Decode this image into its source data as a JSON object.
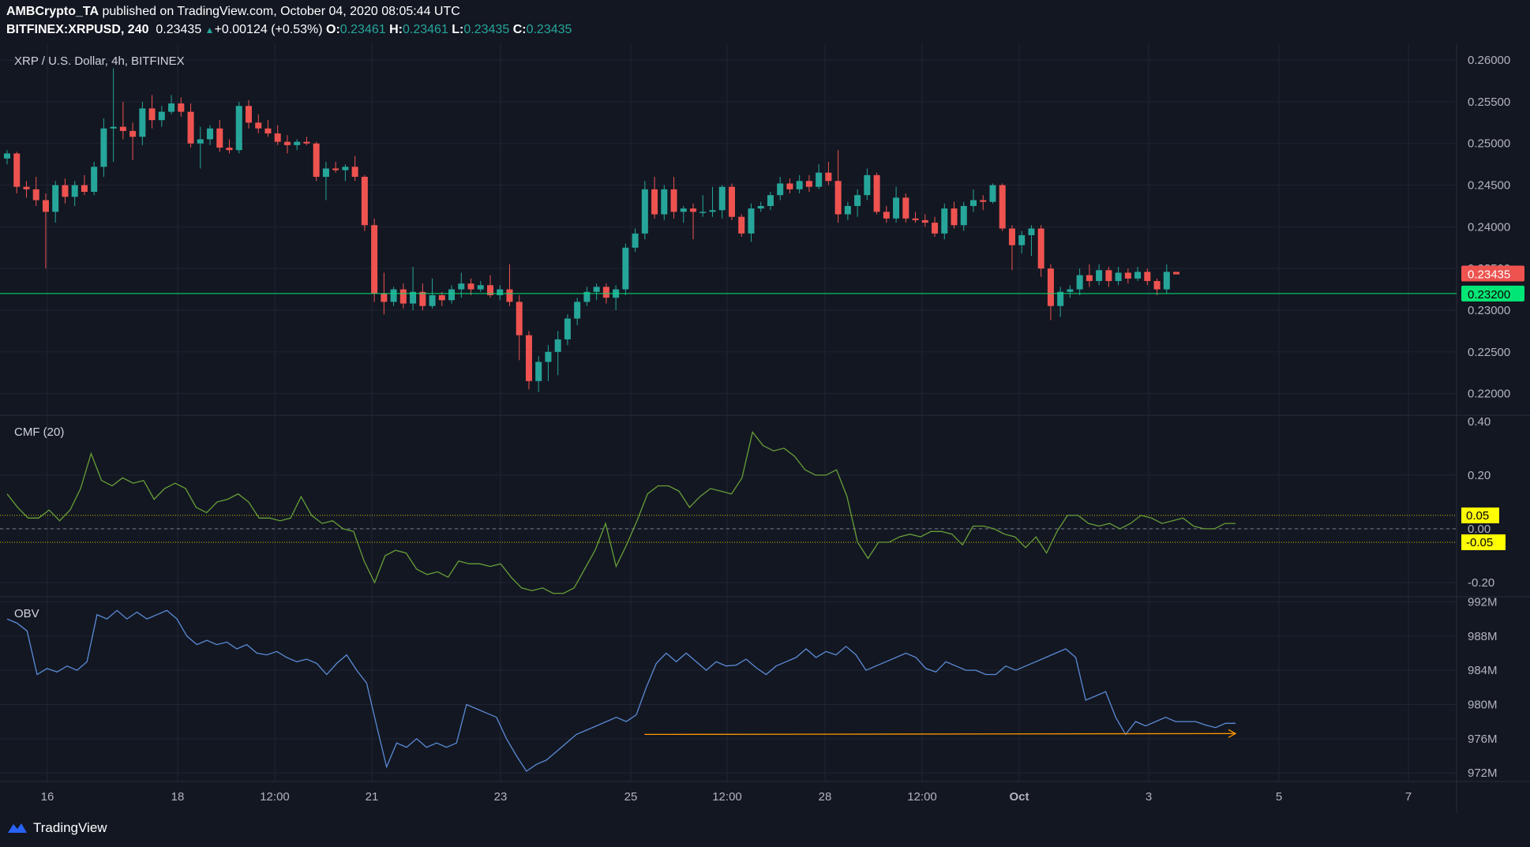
{
  "header": {
    "publisher": "AMBCrypto_TA",
    "published_text": "published on TradingView.com, October 04, 2020 08:05:44 UTC",
    "symbol": "BITFINEX:XRPUSD, 240",
    "last": "0.23435",
    "change": "+0.00124 (+0.53%)",
    "o_label": "O:",
    "o": "0.23461",
    "h_label": "H:",
    "h": "0.23461",
    "l_label": "L:",
    "l": "0.23435",
    "c_label": "C:",
    "c": "0.23435"
  },
  "footer": {
    "brand": "TradingView",
    "logo_icon": "tradingview-logo-icon"
  },
  "colors": {
    "background": "#131722",
    "up": "#26a69a",
    "down": "#ef5350",
    "cmf": "#689f38",
    "obv": "#5b8bd6",
    "level": "#00e676",
    "band": "#ffff00",
    "trend": "#ff9800"
  },
  "chart_data": [
    {
      "type": "candlestick",
      "title": "XRP / U.S. Dollar, 4h, BITFINEX",
      "ylim": [
        0.2175,
        0.262
      ],
      "y_ticks": [
        "0.26000",
        "0.25500",
        "0.25000",
        "0.24500",
        "0.24000",
        "0.23500",
        "0.23000",
        "0.22500",
        "0.22000"
      ],
      "last_price_label": "0.23435",
      "support_level": {
        "value": 0.232,
        "label": "0.23200"
      },
      "x_ticks": [
        "16",
        "18",
        "12:00",
        "21",
        "23",
        "25",
        "12:00",
        "28",
        "12:00",
        "Oct",
        "3",
        "5",
        "7"
      ],
      "ohlc": [
        [
          0.2482,
          0.2492,
          0.2475,
          0.2488
        ],
        [
          0.2488,
          0.249,
          0.244,
          0.2448
        ],
        [
          0.2448,
          0.2455,
          0.2435,
          0.2445
        ],
        [
          0.2445,
          0.246,
          0.2425,
          0.2432
        ],
        [
          0.2432,
          0.244,
          0.235,
          0.2418
        ],
        [
          0.2418,
          0.2455,
          0.2405,
          0.245
        ],
        [
          0.245,
          0.2458,
          0.2428,
          0.2436
        ],
        [
          0.2436,
          0.2455,
          0.2425,
          0.245
        ],
        [
          0.245,
          0.2462,
          0.2438,
          0.2442
        ],
        [
          0.2442,
          0.2478,
          0.2438,
          0.2472
        ],
        [
          0.2472,
          0.253,
          0.246,
          0.2518
        ],
        [
          0.2518,
          0.259,
          0.2478,
          0.252
        ],
        [
          0.252,
          0.255,
          0.2505,
          0.2515
        ],
        [
          0.2515,
          0.2525,
          0.248,
          0.2508
        ],
        [
          0.2508,
          0.255,
          0.2498,
          0.2542
        ],
        [
          0.2542,
          0.2558,
          0.2518,
          0.2528
        ],
        [
          0.2528,
          0.2545,
          0.252,
          0.2538
        ],
        [
          0.2538,
          0.2558,
          0.2535,
          0.2548
        ],
        [
          0.2548,
          0.2555,
          0.2532,
          0.2538
        ],
        [
          0.2538,
          0.2548,
          0.2495,
          0.25
        ],
        [
          0.25,
          0.252,
          0.247,
          0.2505
        ],
        [
          0.2505,
          0.2522,
          0.2498,
          0.2518
        ],
        [
          0.2518,
          0.2528,
          0.249,
          0.2495
        ],
        [
          0.2495,
          0.2505,
          0.2488,
          0.2492
        ],
        [
          0.2492,
          0.255,
          0.2488,
          0.2545
        ],
        [
          0.2545,
          0.2552,
          0.2518,
          0.2525
        ],
        [
          0.2525,
          0.2535,
          0.2512,
          0.2518
        ],
        [
          0.2518,
          0.2528,
          0.2508,
          0.2512
        ],
        [
          0.2512,
          0.2522,
          0.2498,
          0.2502
        ],
        [
          0.2502,
          0.251,
          0.2488,
          0.2498
        ],
        [
          0.2498,
          0.2505,
          0.2492,
          0.2502
        ],
        [
          0.2502,
          0.2508,
          0.2498,
          0.25
        ],
        [
          0.25,
          0.2502,
          0.2455,
          0.246
        ],
        [
          0.246,
          0.2478,
          0.2432,
          0.247
        ],
        [
          0.247,
          0.2478,
          0.2465,
          0.2468
        ],
        [
          0.2468,
          0.2475,
          0.2455,
          0.2472
        ],
        [
          0.2472,
          0.2485,
          0.2455,
          0.246
        ],
        [
          0.246,
          0.2462,
          0.2395,
          0.2402
        ],
        [
          0.2402,
          0.241,
          0.231,
          0.232
        ],
        [
          0.232,
          0.2345,
          0.2295,
          0.231
        ],
        [
          0.231,
          0.2328,
          0.2305,
          0.2325
        ],
        [
          0.2325,
          0.2332,
          0.2302,
          0.2308
        ],
        [
          0.2308,
          0.2352,
          0.23,
          0.2322
        ],
        [
          0.2322,
          0.2332,
          0.23,
          0.2305
        ],
        [
          0.2305,
          0.2338,
          0.2302,
          0.2318
        ],
        [
          0.2318,
          0.2322,
          0.2305,
          0.2312
        ],
        [
          0.2312,
          0.233,
          0.2308,
          0.2325
        ],
        [
          0.2325,
          0.2345,
          0.2315,
          0.2332
        ],
        [
          0.2332,
          0.2338,
          0.2318,
          0.2325
        ],
        [
          0.2325,
          0.2335,
          0.2322,
          0.233
        ],
        [
          0.233,
          0.2342,
          0.2315,
          0.2318
        ],
        [
          0.2318,
          0.233,
          0.2312,
          0.2325
        ],
        [
          0.2325,
          0.2355,
          0.2305,
          0.231
        ],
        [
          0.231,
          0.2318,
          0.224,
          0.227
        ],
        [
          0.227,
          0.2275,
          0.2205,
          0.2215
        ],
        [
          0.2215,
          0.2245,
          0.2202,
          0.2238
        ],
        [
          0.2238,
          0.2258,
          0.2215,
          0.225
        ],
        [
          0.225,
          0.2275,
          0.2222,
          0.2265
        ],
        [
          0.2265,
          0.2295,
          0.2258,
          0.229
        ],
        [
          0.229,
          0.2315,
          0.2282,
          0.231
        ],
        [
          0.231,
          0.2328,
          0.2305,
          0.2322
        ],
        [
          0.2322,
          0.2332,
          0.2312,
          0.2328
        ],
        [
          0.2328,
          0.2332,
          0.2308,
          0.2315
        ],
        [
          0.2315,
          0.233,
          0.23,
          0.2325
        ],
        [
          0.2325,
          0.238,
          0.2318,
          0.2375
        ],
        [
          0.2375,
          0.2398,
          0.237,
          0.2392
        ],
        [
          0.2392,
          0.2455,
          0.2385,
          0.2445
        ],
        [
          0.2445,
          0.246,
          0.241,
          0.2415
        ],
        [
          0.2415,
          0.245,
          0.2408,
          0.2445
        ],
        [
          0.2445,
          0.246,
          0.241,
          0.2418
        ],
        [
          0.2418,
          0.2425,
          0.2405,
          0.2422
        ],
        [
          0.2422,
          0.2428,
          0.2385,
          0.2418
        ],
        [
          0.2418,
          0.2438,
          0.2412,
          0.2418
        ],
        [
          0.2418,
          0.2448,
          0.2412,
          0.242
        ],
        [
          0.242,
          0.245,
          0.241,
          0.2448
        ],
        [
          0.2448,
          0.2452,
          0.2408,
          0.2412
        ],
        [
          0.2412,
          0.2415,
          0.2388,
          0.2392
        ],
        [
          0.2392,
          0.2428,
          0.2382,
          0.2422
        ],
        [
          0.2422,
          0.243,
          0.2418,
          0.2425
        ],
        [
          0.2425,
          0.2442,
          0.242,
          0.2438
        ],
        [
          0.2438,
          0.246,
          0.2432,
          0.2452
        ],
        [
          0.2452,
          0.2458,
          0.244,
          0.2445
        ],
        [
          0.2445,
          0.2462,
          0.244,
          0.2455
        ],
        [
          0.2455,
          0.2462,
          0.2442,
          0.2448
        ],
        [
          0.2448,
          0.2475,
          0.2445,
          0.2465
        ],
        [
          0.2465,
          0.2478,
          0.245,
          0.2455
        ],
        [
          0.2455,
          0.2492,
          0.2405,
          0.2415
        ],
        [
          0.2415,
          0.243,
          0.2408,
          0.2425
        ],
        [
          0.2425,
          0.2445,
          0.2412,
          0.2438
        ],
        [
          0.2438,
          0.247,
          0.2432,
          0.2462
        ],
        [
          0.2462,
          0.2465,
          0.2415,
          0.2418
        ],
        [
          0.2418,
          0.2425,
          0.2405,
          0.241
        ],
        [
          0.241,
          0.2448,
          0.2405,
          0.2435
        ],
        [
          0.2435,
          0.244,
          0.2405,
          0.241
        ],
        [
          0.241,
          0.2418,
          0.2405,
          0.2408
        ],
        [
          0.2408,
          0.2415,
          0.24,
          0.2405
        ],
        [
          0.2405,
          0.2412,
          0.2388,
          0.2392
        ],
        [
          0.2392,
          0.2428,
          0.2385,
          0.2422
        ],
        [
          0.2422,
          0.243,
          0.2398,
          0.2402
        ],
        [
          0.2402,
          0.243,
          0.2395,
          0.2425
        ],
        [
          0.2425,
          0.2445,
          0.2418,
          0.2432
        ],
        [
          0.2432,
          0.2438,
          0.242,
          0.243
        ],
        [
          0.243,
          0.2452,
          0.2428,
          0.245
        ],
        [
          0.245,
          0.2452,
          0.2395,
          0.2398
        ],
        [
          0.2398,
          0.2402,
          0.2348,
          0.2378
        ],
        [
          0.2378,
          0.2395,
          0.2368,
          0.239
        ],
        [
          0.239,
          0.2402,
          0.2365,
          0.2398
        ],
        [
          0.2398,
          0.2402,
          0.234,
          0.235
        ],
        [
          0.235,
          0.2355,
          0.2288,
          0.2305
        ],
        [
          0.2305,
          0.2328,
          0.2292,
          0.2322
        ],
        [
          0.2322,
          0.233,
          0.2315,
          0.2325
        ],
        [
          0.2325,
          0.235,
          0.2318,
          0.2342
        ],
        [
          0.2342,
          0.2355,
          0.2328,
          0.2335
        ],
        [
          0.2335,
          0.2355,
          0.233,
          0.2348
        ],
        [
          0.2348,
          0.2352,
          0.2328,
          0.2335
        ],
        [
          0.2335,
          0.2352,
          0.233,
          0.2345
        ],
        [
          0.2345,
          0.235,
          0.2332,
          0.2338
        ],
        [
          0.2338,
          0.2352,
          0.2335,
          0.2346
        ],
        [
          0.2346,
          0.235,
          0.233,
          0.2335
        ],
        [
          0.2335,
          0.2338,
          0.2318,
          0.2325
        ],
        [
          0.2325,
          0.2355,
          0.232,
          0.2346
        ],
        [
          0.2346,
          0.2346,
          0.2343,
          0.2343
        ]
      ]
    },
    {
      "type": "line",
      "title": "CMF (20)",
      "ylim": [
        -0.25,
        0.42
      ],
      "y_ticks": [
        "0.40",
        "0.20",
        "0.00",
        "-0.20"
      ],
      "band_labels": [
        "0.05",
        "-0.05"
      ],
      "bands": [
        0.05,
        -0.05
      ],
      "zero": 0,
      "values": [
        0.13,
        0.08,
        0.04,
        0.04,
        0.07,
        0.03,
        0.07,
        0.15,
        0.28,
        0.18,
        0.16,
        0.19,
        0.17,
        0.18,
        0.11,
        0.15,
        0.17,
        0.15,
        0.08,
        0.06,
        0.1,
        0.11,
        0.13,
        0.1,
        0.04,
        0.04,
        0.03,
        0.04,
        0.12,
        0.05,
        0.02,
        0.03,
        0.0,
        -0.01,
        -0.12,
        -0.2,
        -0.1,
        -0.08,
        -0.09,
        -0.15,
        -0.17,
        -0.16,
        -0.18,
        -0.12,
        -0.13,
        -0.13,
        -0.14,
        -0.13,
        -0.18,
        -0.22,
        -0.23,
        -0.22,
        -0.24,
        -0.24,
        -0.22,
        -0.15,
        -0.08,
        0.02,
        -0.14,
        -0.06,
        0.03,
        0.13,
        0.16,
        0.16,
        0.14,
        0.08,
        0.12,
        0.15,
        0.14,
        0.13,
        0.19,
        0.36,
        0.31,
        0.29,
        0.3,
        0.27,
        0.22,
        0.2,
        0.2,
        0.22,
        0.12,
        -0.05,
        -0.11,
        -0.05,
        -0.05,
        -0.03,
        -0.02,
        -0.03,
        -0.01,
        -0.01,
        -0.02,
        -0.06,
        0.01,
        0.01,
        0.0,
        -0.02,
        -0.03,
        -0.07,
        -0.03,
        -0.09,
        -0.01,
        0.05,
        0.05,
        0.02,
        0.01,
        0.02,
        0.0,
        0.02,
        0.05,
        0.04,
        0.02,
        0.03,
        0.04,
        0.01,
        0.0,
        0.0,
        0.02,
        0.02
      ]
    },
    {
      "type": "line",
      "title": "OBV",
      "ylim": [
        971.0,
        992.5
      ],
      "y_ticks": [
        "992M",
        "988M",
        "984M",
        "980M",
        "976M",
        "972M"
      ],
      "values": [
        990.0,
        989.5,
        988.6,
        983.5,
        984.2,
        983.8,
        984.5,
        984.0,
        985.0,
        990.5,
        990.0,
        991.0,
        990.0,
        990.8,
        990.0,
        990.5,
        991.0,
        990.0,
        988.0,
        987.0,
        987.5,
        987.0,
        987.3,
        986.5,
        987.0,
        986.0,
        985.8,
        986.2,
        985.5,
        985.0,
        985.3,
        984.8,
        983.5,
        984.8,
        985.8,
        984.0,
        982.5,
        977.5,
        972.7,
        975.5,
        975.0,
        976.0,
        975.0,
        975.5,
        975.0,
        975.5,
        980.0,
        979.5,
        979.0,
        978.5,
        976.0,
        974.0,
        972.2,
        973.0,
        973.5,
        974.5,
        975.5,
        976.5,
        977.0,
        977.5,
        978.0,
        978.5,
        978.0,
        978.8,
        982.0,
        984.8,
        986.0,
        985.0,
        986.0,
        985.0,
        984.0,
        985.0,
        984.5,
        984.6,
        985.3,
        984.3,
        983.5,
        984.5,
        985.0,
        985.5,
        986.5,
        985.5,
        986.2,
        985.8,
        986.8,
        985.8,
        984.0,
        984.5,
        985.0,
        985.5,
        986.0,
        985.5,
        984.2,
        983.8,
        985.0,
        984.5,
        984.0,
        984.0,
        983.5,
        983.5,
        984.5,
        984.0,
        984.5,
        985.0,
        985.5,
        986.0,
        986.5,
        985.5,
        980.5,
        981.0,
        981.5,
        978.5,
        976.5,
        978.0,
        977.5,
        978.0,
        978.5,
        978.0,
        978.0,
        978.0,
        977.6,
        977.3,
        977.8,
        977.8
      ],
      "trend_line": {
        "start_index": 62,
        "end_index": 123,
        "from_value": 976.5,
        "to_value": 976.6
      }
    }
  ]
}
